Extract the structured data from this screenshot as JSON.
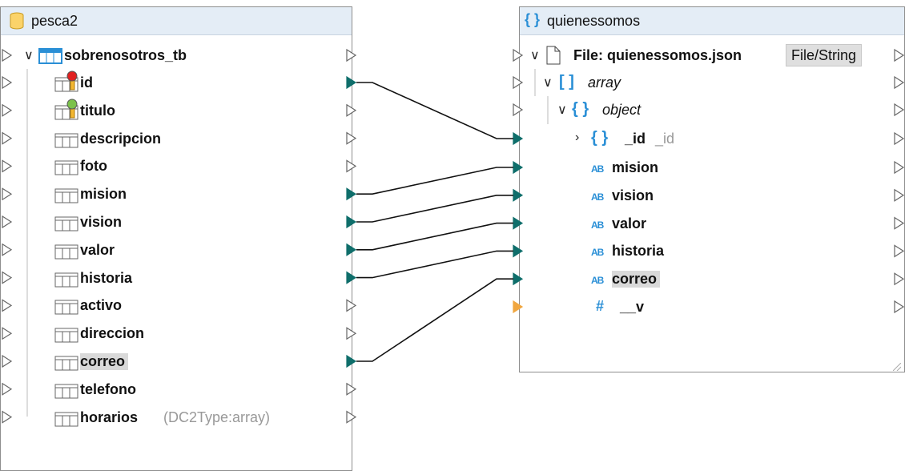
{
  "source": {
    "title": "pesca2",
    "table": "sobrenosotros_tb",
    "fields": [
      {
        "label": "id",
        "key": "primary"
      },
      {
        "label": "titulo",
        "key": "unique"
      },
      {
        "label": "descripcion"
      },
      {
        "label": "foto"
      },
      {
        "label": "mision"
      },
      {
        "label": "vision"
      },
      {
        "label": "valor"
      },
      {
        "label": "historia"
      },
      {
        "label": "activo"
      },
      {
        "label": "direccion"
      },
      {
        "label": "correo",
        "selected": true
      },
      {
        "label": "telefono"
      },
      {
        "label": "horarios",
        "note": "(DC2Type:array)"
      }
    ]
  },
  "target": {
    "title": "quienessomos",
    "file_label": "File: quienessomos.json",
    "file_button": "File/String",
    "array_label": "array",
    "object_label": "object",
    "id_label": "_id",
    "id_note": "_id",
    "strings": [
      "mision",
      "vision",
      "valor",
      "historia",
      "correo"
    ],
    "number_label": "__v",
    "ab_glyph": "AB",
    "brace_glyph": "{ }",
    "bracket_glyph": "[ ]",
    "hash_glyph": "#"
  },
  "connections": [
    {
      "from": "id",
      "to": "_id"
    },
    {
      "from": "mision",
      "to": "mision"
    },
    {
      "from": "vision",
      "to": "vision"
    },
    {
      "from": "valor",
      "to": "valor"
    },
    {
      "from": "historia",
      "to": "historia"
    },
    {
      "from": "correo",
      "to": "correo"
    }
  ],
  "colors": {
    "connected_connector": "#0f6e6b",
    "open_connector": "#6b6b6b",
    "number_connector": "#f0a640",
    "header_bg": "#e4edf6",
    "accent": "#2a8fd6"
  }
}
